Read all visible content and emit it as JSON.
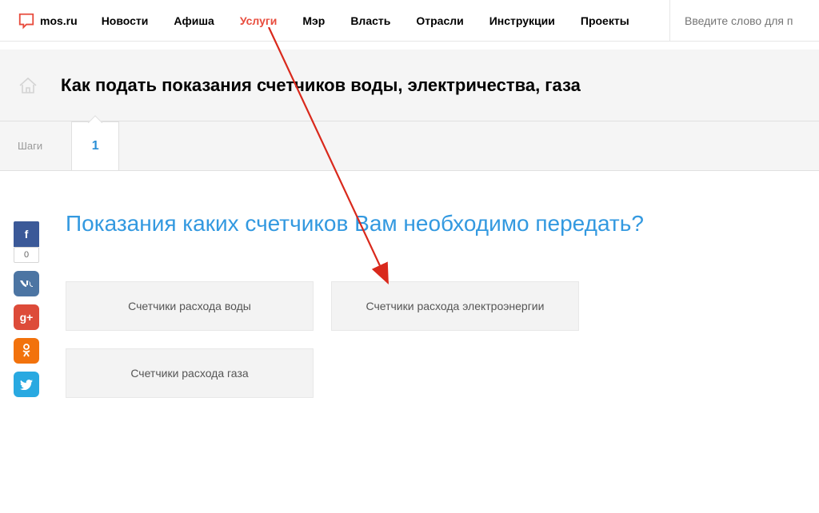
{
  "header": {
    "logo_text": "mos.ru",
    "nav": [
      {
        "label": "Новости"
      },
      {
        "label": "Афиша"
      },
      {
        "label": "Услуги",
        "active": true
      },
      {
        "label": "Мэр"
      },
      {
        "label": "Власть"
      },
      {
        "label": "Отрасли"
      },
      {
        "label": "Инструкции"
      },
      {
        "label": "Проекты"
      }
    ],
    "search_placeholder": "Введите слово для п"
  },
  "page": {
    "title": "Как подать показания счетчиков воды, электричества, газа"
  },
  "steps": {
    "label": "Шаги",
    "current": "1"
  },
  "content": {
    "question": "Показания каких счетчиков Вам необходимо передать?",
    "options": [
      {
        "label": "Счетчики расхода воды"
      },
      {
        "label": "Счетчики расхода электроэнергии"
      },
      {
        "label": "Счетчики расхода газа"
      }
    ]
  },
  "social": {
    "fb": "f",
    "fb_count": "0",
    "vk": "W",
    "gp": "g+",
    "ok": "ǒ",
    "tw": "t"
  }
}
